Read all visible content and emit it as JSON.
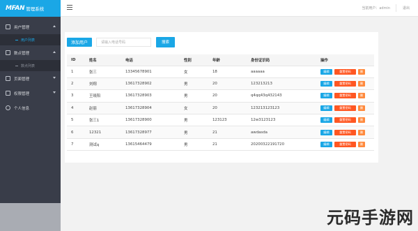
{
  "sidebar": {
    "logo_brand": "MFAN",
    "logo_sub": "管理系统",
    "items": [
      {
        "label": "用户管理",
        "arrow": "up",
        "icon": "grid-icon"
      },
      {
        "label": "用户列表",
        "sub": true,
        "active": true
      },
      {
        "label": "数点管理",
        "arrow": "up",
        "icon": "grid-icon"
      },
      {
        "label": "数点列表",
        "sub": true,
        "active": false
      },
      {
        "label": "页面管理",
        "arrow": "down",
        "icon": "grid-icon"
      },
      {
        "label": "权限管理",
        "arrow": "down",
        "icon": "grid-icon"
      },
      {
        "label": "个人信息",
        "icon": "user-icon"
      }
    ]
  },
  "topbar": {
    "user_text": "当前用户：admin",
    "logout_label": "退出"
  },
  "toolbar": {
    "add_label": "添加用户",
    "search_placeholder": "请输入电话号码",
    "search_label": "搜索"
  },
  "table": {
    "headers": [
      "ID",
      "姓名",
      "电话",
      "性别",
      "年龄",
      "身份证识码",
      "操作"
    ],
    "rows": [
      [
        "1",
        "张三",
        "13345678901",
        "女",
        "18",
        "aaaaaa"
      ],
      [
        "2",
        "刘翔",
        "13617328902",
        "男",
        "20",
        "123213213"
      ],
      [
        "3",
        "王晓阳",
        "13617328903",
        "男",
        "20",
        "q4qq43q432143"
      ],
      [
        "4",
        "赵丽",
        "13617328904",
        "女",
        "20",
        "123213123123"
      ],
      [
        "5",
        "张三1",
        "13617328900",
        "男",
        "123123",
        "12w3123123"
      ],
      [
        "6",
        "12321",
        "13617328977",
        "男",
        "21",
        "awdasda"
      ],
      [
        "7",
        "测试q",
        "13615464479",
        "男",
        "21",
        "20200322191720"
      ]
    ],
    "ops": {
      "edit": "编辑",
      "reset": "重置密码",
      "del": "删"
    }
  },
  "watermark": "元码手游网"
}
